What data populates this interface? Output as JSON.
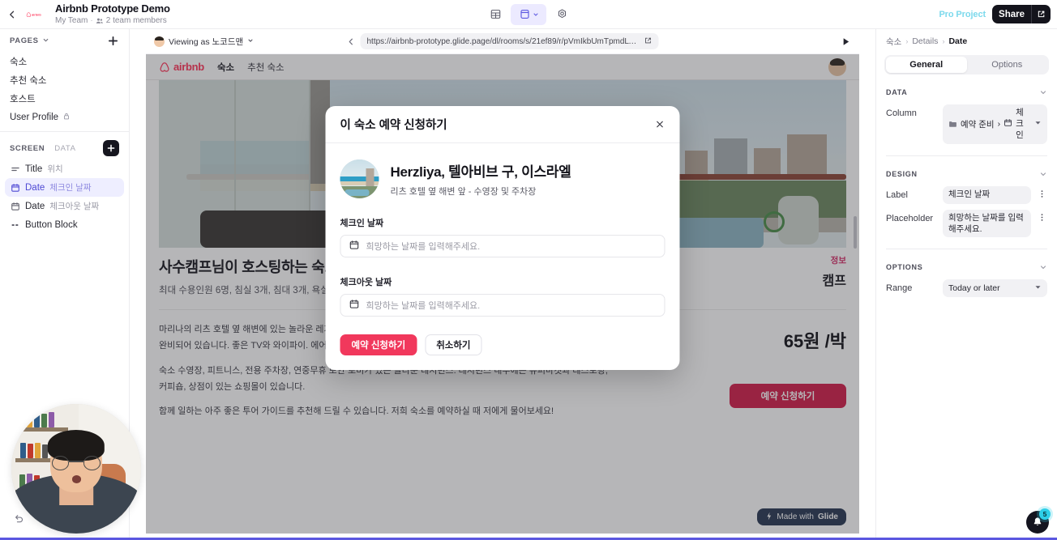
{
  "topbar": {
    "back_icon": "chevron-left-icon",
    "app_logo": "airbnb-logo-icon",
    "title": "Airbnb Prototype Demo",
    "team": "My Team",
    "separator": "·",
    "members": "2 team members",
    "members_icon": "people-icon",
    "center_icons": [
      {
        "name": "table-icon",
        "label": "Data"
      },
      {
        "name": "layout-icon",
        "label": "Layout"
      },
      {
        "name": "settings-icon",
        "label": "Settings"
      }
    ],
    "pro_label": "Pro Project",
    "share_label": "Share",
    "share_icon": "external-link-icon"
  },
  "left_panel": {
    "pages_header": "PAGES",
    "pages_chevron_icon": "chevron-down-icon",
    "add_page_icon": "plus-icon",
    "pages": [
      {
        "label": "숙소",
        "locked": false
      },
      {
        "label": "추천 숙소",
        "locked": false
      },
      {
        "label": "호스트",
        "locked": false
      },
      {
        "label": "User Profile",
        "locked": true,
        "lock_icon": "lock-icon"
      }
    ],
    "tabs": [
      {
        "label": "SCREEN",
        "active": true
      },
      {
        "label": "DATA",
        "active": false
      }
    ],
    "add_component_icon": "plus-icon",
    "components": [
      {
        "icon": "text-lines-icon",
        "name": "Title",
        "hint": "위치",
        "selected": false
      },
      {
        "icon": "calendar-icon",
        "name": "Date",
        "hint": "체크인 날짜",
        "selected": true
      },
      {
        "icon": "calendar-icon",
        "name": "Date",
        "hint": "체크아웃 날짜",
        "selected": false
      },
      {
        "icon": "buttons-icon",
        "name": "Button Block",
        "hint": "",
        "selected": false
      }
    ],
    "undo_icon": "undo-icon",
    "redo_icon": "redo-icon"
  },
  "preview": {
    "viewing_as": "Viewing as 노코드맨",
    "viewing_chevron_icon": "chevron-down-icon",
    "back_icon": "chevron-left-icon",
    "url": "https://airbnb-prototype.glide.page/dl/rooms/s/21ef89/r/pVmIkbUmTpmdLTrpNfIvTg/...",
    "open_icon": "external-link-icon",
    "play_icon": "play-icon",
    "site": {
      "brand": "airbnb",
      "brand_icon": "airbnb-logo-icon",
      "nav": [
        "숙소",
        "추천 숙소"
      ],
      "avatar": "user-avatar",
      "title": "사수캠프님이 호스팅하는 숙소",
      "meta": "최대 수용인원 6명, 침실 3개, 침대 3개, 욕실 3개",
      "tag": "정보",
      "camp": "캠프",
      "price": "65원 /박",
      "cta": "예약 신청하기",
      "paragraphs": [
        "마리나의 리츠 호텔 옆 해변에 있는 놀라운 레지던스. 침실 3개와 욕실 3개가 있는 매우 넓은 아파트 - 바다. 주방에는 시설이 완비되어 있습니다. 좋은 TV와 와이파이. 에어컨이 완벽하게 작동합니다. 세탁기와 건조기.",
        "숙소 수영장, 피트니스, 전용 주차장, 연중무휴 보안 로비가 있는 놀라운 레지던스. 레지던스 내부에는 슈퍼마켓과 레스토랑, 커피숍, 상점이 있는 쇼핑몰이 있습니다.",
        "함께 일하는 아주 좋은 투어 가이드를 추천해 드릴 수 있습니다. 저희 숙소를 예약하실 때 저에게 물어보세요!"
      ]
    },
    "made_with_prefix": "Made with",
    "made_with_brand": "Glide",
    "made_with_icon": "bolt-icon"
  },
  "modal": {
    "title": "이 숙소 예약 신청하기",
    "close_icon": "close-icon",
    "thumb": "listing-thumbnail",
    "listing_name": "Herzliya, 텔아비브 구, 이스라엘",
    "listing_desc": "리츠 호텔 옆 해변 앞 - 수영장 및 주차장",
    "checkin_label": "체크인 날짜",
    "checkin_placeholder": "희망하는 날짜를 입력해주세요.",
    "checkout_label": "체크아웃 날짜",
    "checkout_placeholder": "희망하는 날짜를 입력해주세요.",
    "calendar_icon": "calendar-icon",
    "submit_label": "예약 신청하기",
    "cancel_label": "취소하기"
  },
  "right_panel": {
    "breadcrumb": [
      "숙소",
      "Details",
      "Date"
    ],
    "breadcrumb_sep": "›",
    "tabs": [
      {
        "label": "General",
        "active": true
      },
      {
        "label": "Options",
        "active": false
      }
    ],
    "sections": [
      {
        "title": "DATA",
        "chevron_icon": "chevron-down-icon",
        "rows": [
          {
            "label": "Column",
            "folder_icon": "folder-icon",
            "value_prefix": "예약 준비",
            "arrow": "›",
            "calendar_icon": "calendar-icon",
            "value": "체크인",
            "control": "dropdown",
            "dropdown_icon": "caret-down-icon"
          }
        ]
      },
      {
        "title": "DESIGN",
        "chevron_icon": "chevron-down-icon",
        "rows": [
          {
            "label": "Label",
            "value": "체크인 날짜",
            "control": "text",
            "menu_icon": "more-vertical-icon"
          },
          {
            "label": "Placeholder",
            "value": "희망하는 날짜를 입력해주세요.",
            "control": "text",
            "menu_icon": "more-vertical-icon"
          }
        ]
      },
      {
        "title": "OPTIONS",
        "chevron_icon": "chevron-down-icon",
        "rows": [
          {
            "label": "Range",
            "value": "Today or later",
            "control": "dropdown",
            "dropdown_icon": "caret-down-icon"
          }
        ]
      }
    ]
  },
  "notification": {
    "icon": "bell-icon",
    "count": "5"
  },
  "colors": {
    "accent_purple": "#5b57e0",
    "airbnb_red": "#FF385C",
    "cta_red": "#d4204c",
    "pro_cyan": "#7cd9ec",
    "badge_cyan": "#2ecfe8"
  }
}
